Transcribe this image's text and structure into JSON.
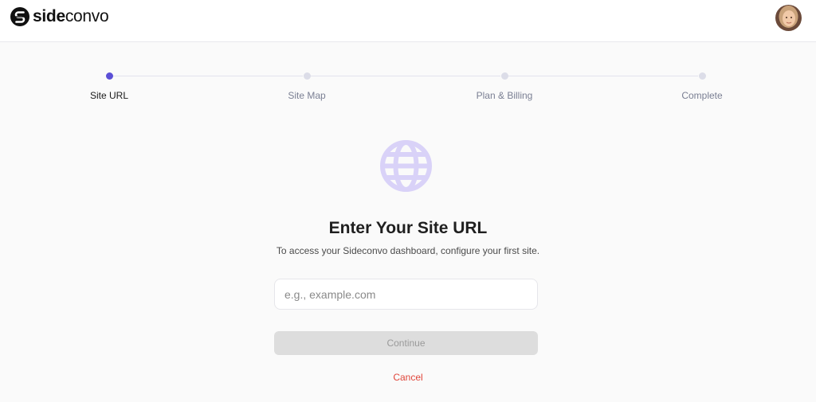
{
  "header": {
    "logo_bold": "side",
    "logo_light": "convo",
    "logo_icon": "sideconvo-s-icon",
    "avatar_icon": "user-avatar"
  },
  "stepper": {
    "steps": [
      {
        "label": "Site URL",
        "active": true
      },
      {
        "label": "Site Map",
        "active": false
      },
      {
        "label": "Plan & Billing",
        "active": false
      },
      {
        "label": "Complete",
        "active": false
      }
    ],
    "active_color": "#5b4fd6",
    "inactive_color": "#dcdde8"
  },
  "main": {
    "icon": "globe-icon",
    "title": "Enter Your Site URL",
    "subtitle": "To access your Sideconvo dashboard, configure your first site.",
    "input_placeholder": "e.g., example.com",
    "input_value": "",
    "continue_label": "Continue",
    "cancel_label": "Cancel"
  },
  "colors": {
    "accent": "#5b4fd6",
    "globe": "#d9d2f8",
    "cancel": "#e0463b"
  }
}
